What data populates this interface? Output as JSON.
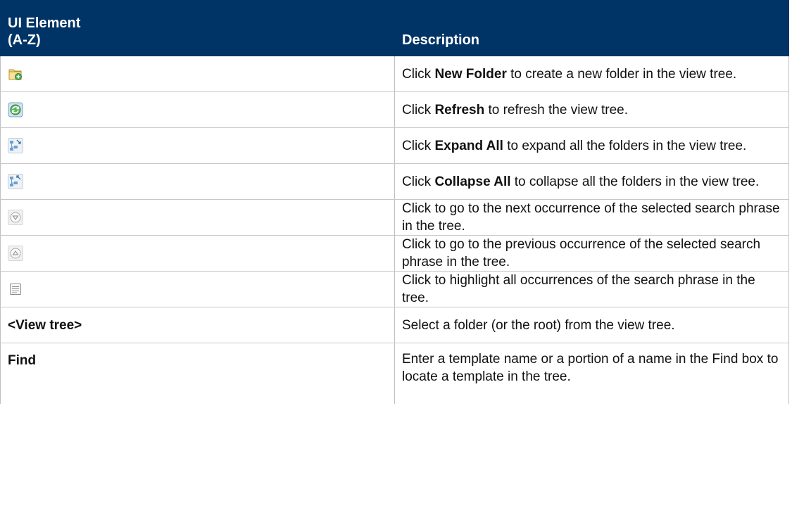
{
  "table": {
    "headers": {
      "element": "UI Element (A-Z)",
      "element_line1": "UI Element",
      "element_line2": "(A-Z)",
      "description": "Description"
    },
    "rows": [
      {
        "element_icon": "new-folder-icon",
        "pre": "Click ",
        "bold": "New Folder",
        "post": " to create a new folder in the view tree."
      },
      {
        "element_icon": "refresh-icon",
        "pre": "Click ",
        "bold": "Refresh",
        "post": " to refresh the view tree."
      },
      {
        "element_icon": "expand-all-icon",
        "pre": "Click ",
        "bold": "Expand All",
        "post": " to expand all the folders in the view tree."
      },
      {
        "element_icon": "collapse-all-icon",
        "pre": "Click ",
        "bold": "Collapse All",
        "post": " to collapse all the folders in the view tree."
      },
      {
        "element_icon": "next-occurrence-icon",
        "text": "Click to go to the next occurrence of the selected search phrase in the tree."
      },
      {
        "element_icon": "previous-occurrence-icon",
        "text": "Click to go to the previous occurrence of the selected search phrase in the tree."
      },
      {
        "element_icon": "highlight-all-icon",
        "text": "Click to highlight all occurrences of the search phrase in the tree."
      },
      {
        "element_text": "<View tree>",
        "text": "Select a folder (or the root) from the view tree."
      },
      {
        "element_text": "Find",
        "text": "Enter a template name or a portion of a name in the Find box to locate a template in the tree."
      }
    ]
  },
  "colors": {
    "header_bg": "#003366",
    "header_text": "#ffffff",
    "border": "#bfbfbf"
  }
}
